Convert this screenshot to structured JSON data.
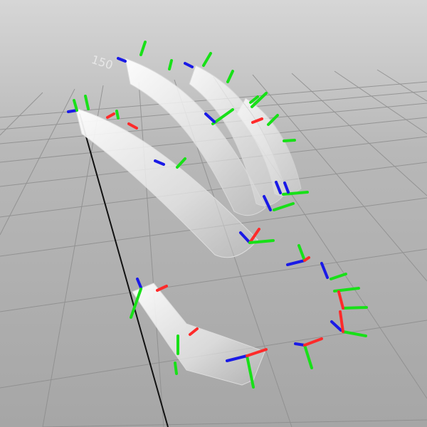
{
  "viewport": {
    "label": "150"
  },
  "colors": {
    "axis_x": "#ff2a2a",
    "axis_y": "#18e018",
    "axis_z": "#1a1ae6",
    "grid": "#8a8a8a",
    "background_top": "#cfcfcf",
    "background_bottom": "#9b9b9b",
    "mesh": "#f2f2f2"
  },
  "objects": {
    "fingers": [
      "index-finger",
      "middle-finger",
      "ring-finger",
      "pinky-finger"
    ],
    "thumb": "thumb"
  }
}
